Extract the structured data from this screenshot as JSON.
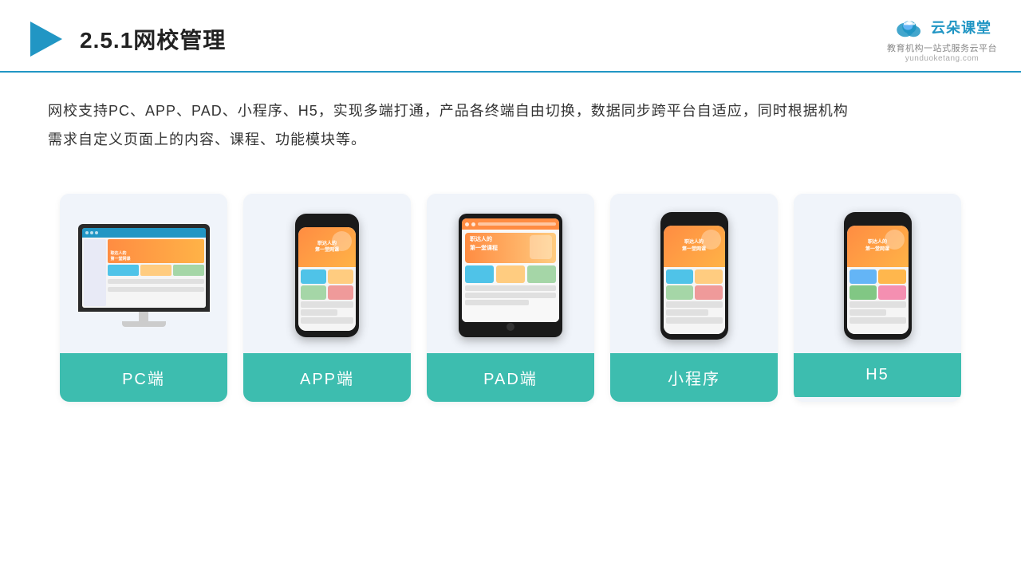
{
  "header": {
    "title": "2.5.1网校管理",
    "logo_name": "云朵课堂",
    "logo_url": "yunduoketang.com",
    "logo_tagline": "教育机构一站\n式服务云平台"
  },
  "description": {
    "text1": "网校支持PC、APP、PAD、小程序、H5，实现多端打通，产品各终端自由切换，数据同步跨平台自适应，同时根据机构",
    "text2": "需求自定义页面上的内容、课程、功能模块等。"
  },
  "cards": [
    {
      "id": "pc",
      "label": "PC端"
    },
    {
      "id": "app",
      "label": "APP端"
    },
    {
      "id": "pad",
      "label": "PAD端"
    },
    {
      "id": "miniprogram",
      "label": "小程序"
    },
    {
      "id": "h5",
      "label": "H5"
    }
  ],
  "colors": {
    "accent": "#3dbdaf",
    "header_line": "#2196c4",
    "card_bg": "#f0f4fa"
  }
}
